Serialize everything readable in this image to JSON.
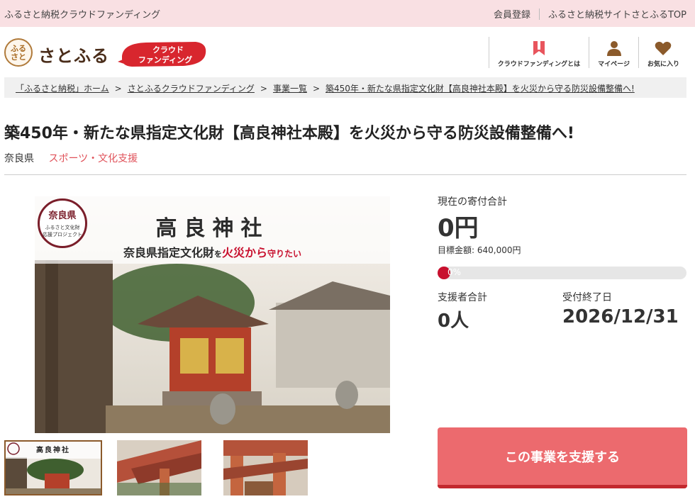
{
  "topbar": {
    "tagline": "ふるさと納税クラウドファンディング",
    "links": [
      "会員登録",
      "ふるさと納税サイトさとふるTOP"
    ]
  },
  "header": {
    "logo_text": "さとふる",
    "logo_seal": "ふるさと",
    "badge_line1": "クラウド",
    "badge_line2": "ファンディング",
    "nav": [
      {
        "label": "クラウドファンディングとは",
        "icon": "bookmark-icon"
      },
      {
        "label": "マイページ",
        "icon": "user-icon"
      },
      {
        "label": "お気に入り",
        "icon": "heart-icon"
      }
    ]
  },
  "breadcrumb": [
    "「ふるさと納税」ホーム",
    "さとふるクラウドファンディング",
    "事業一覧",
    "築450年・新たな県指定文化財【高良神社本殿】を火災から守る防災設備整備へ!"
  ],
  "breadcrumb_separator": ">",
  "project": {
    "title": "築450年・新たな県指定文化財【高良神社本殿】を火災から守る防災設備整備へ!",
    "region": "奈良県",
    "category": "スポーツ・文化支援"
  },
  "image": {
    "seal_line1": "奈良県",
    "seal_line2": "ふるさと文化財",
    "seal_line3": "応援プロジェクト",
    "heading": "高良神社",
    "subheading_a": "奈良県指定文化財",
    "subheading_b": "を",
    "subheading_c": "火災から",
    "subheading_d": "守りたい",
    "thumb_heading": "高良神社"
  },
  "stats": {
    "current_label": "現在の寄付合計",
    "current_value": "0円",
    "goal_text": "目標金額: 640,000円",
    "progress_text": "0%",
    "progress_percent": 0,
    "supporters_label": "支援者合計",
    "supporters_value": "0人",
    "deadline_label": "受付終了日",
    "deadline_value": "2026/12/31"
  },
  "cta": {
    "label": "この事業を支援する"
  },
  "colors": {
    "accent": "#ec6a6e",
    "category": "#e0525a",
    "topbar_bg": "#f9e0e3",
    "progress_fill": "#c8102e"
  }
}
